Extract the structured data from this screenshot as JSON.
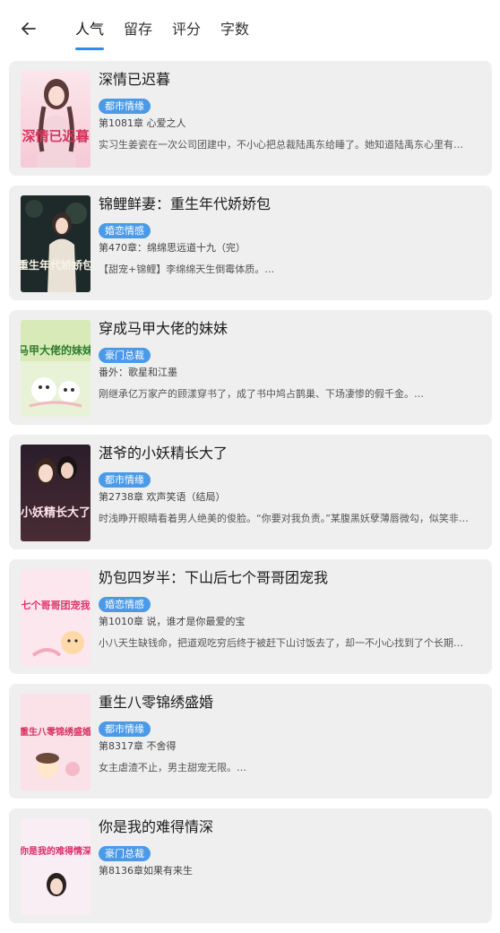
{
  "header": {
    "back_icon": "arrow-left-icon",
    "tabs": [
      {
        "label": "人气",
        "active": true
      },
      {
        "label": "留存",
        "active": false
      },
      {
        "label": "评分",
        "active": false
      },
      {
        "label": "字数",
        "active": false
      }
    ]
  },
  "colors": {
    "accent": "#2d8cf0",
    "tag_bg": "#4a9ae8",
    "card_bg": "#efefef"
  },
  "books": [
    {
      "title": "深情已迟暮",
      "tag": "都市情缘",
      "chapter": "第1081章 心爱之人",
      "desc": "实习生姜瓷在一次公司团建中，不小心把总裁陆禹东给睡了。她知道陆禹东心里有…",
      "cover_text": "深情已迟暮"
    },
    {
      "title": "锦鲤鲜妻：重生年代娇娇包",
      "tag": "婚恋情感",
      "chapter": "第470章：绵绵思远道十九（完）",
      "desc": "【甜宠+锦鲤】李绵绵天生倒霉体质。…",
      "cover_text": "重生年代娇娇包"
    },
    {
      "title": "穿成马甲大佬的妹妹",
      "tag": "豪门总裁",
      "chapter": "番外：歌星和江墨",
      "desc": "刚继承亿万家产的顾漾穿书了，成了书中鸠占鹊巢、下场凄惨的假千金。…",
      "cover_text": "马甲大佬的妹妹"
    },
    {
      "title": "湛爷的小妖精长大了",
      "tag": "都市情缘",
      "chapter": "第2738章 欢声笑语（结局）",
      "desc": "时浅睁开眼睛看着男人绝美的俊脸。“你要对我负责。”某腹黑妖孽薄唇微勾，似笑非…",
      "cover_text": "小妖精长大了"
    },
    {
      "title": "奶包四岁半：下山后七个哥哥团宠我",
      "tag": "婚恋情感",
      "chapter": "第1010章 说，谁才是你最爱的宝",
      "desc": "小八天生缺钱命，把道观吃穷后终于被赶下山讨饭去了，却一不小心找到了个长期…",
      "cover_text": "七个哥哥团宠我"
    },
    {
      "title": "重生八零锦绣盛婚",
      "tag": "都市情缘",
      "chapter": "第8317章 不舍得",
      "desc": "女主虐渣不止，男主甜宠无限。…",
      "cover_text": "重生八零锦绣盛婚"
    },
    {
      "title": "你是我的难得情深",
      "tag": "豪门总裁",
      "chapter": "第8136章如果有来生",
      "desc": "",
      "cover_text": "你是我的难得情深"
    }
  ]
}
